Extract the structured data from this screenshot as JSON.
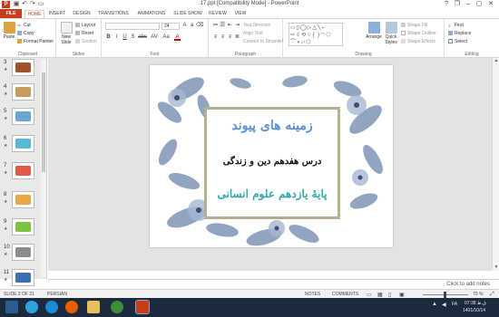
{
  "titlebar": {
    "title": "17.ppt [Compatibility Mode] - PowerPoint",
    "app_logo": "P",
    "quick_access": [
      "save-icon",
      "undo-icon",
      "redo-icon",
      "slideshow-icon"
    ],
    "controls": {
      "help": "?",
      "restore": "❐",
      "minimize": "–",
      "maximize": "▢",
      "close": "✕"
    }
  },
  "tabs": [
    "FILE",
    "HOME",
    "INSERT",
    "DESIGN",
    "TRANSITIONS",
    "ANIMATIONS",
    "SLIDE SHOW",
    "REVIEW",
    "VIEW"
  ],
  "active_tab": "HOME",
  "signin": "",
  "ribbon": {
    "clipboard": {
      "paste": "Paste",
      "cut": "Cut",
      "copy": "Copy",
      "format_painter": "Format Painter",
      "label": "Clipboard"
    },
    "slides": {
      "new_slide": "New Slide",
      "layout": "Layout",
      "reset": "Reset",
      "section": "Section",
      "label": "Slides"
    },
    "font": {
      "font_name": "",
      "font_size": "24",
      "label": "Font",
      "buttons": [
        "B",
        "I",
        "U",
        "S",
        "abc",
        "AV",
        "Aa",
        "A"
      ]
    },
    "paragraph": {
      "text_direction": "Text Direction",
      "align_text": "Align Text",
      "convert_smartart": "Convert to SmartArt",
      "label": "Paragraph"
    },
    "drawing": {
      "arrange": "Arrange",
      "quick_styles": "Quick Styles",
      "shape_fill": "Shape Fill",
      "shape_outline": "Shape Outline",
      "shape_effects": "Shape Effects",
      "label": "Drawing",
      "shapes_glyphs": "▭▯◯▷△╲⌐ ⇨⇩⟲☆{ }◠⬠ ⌒◖▱⬡"
    },
    "editing": {
      "find": "Find",
      "replace": "Replace",
      "select": "Select",
      "label": "Editing"
    }
  },
  "thumbnails": [
    {
      "number": "3",
      "star": "★",
      "selected": false,
      "color": "#a0522d"
    },
    {
      "number": "4",
      "star": "★",
      "selected": false,
      "color": "#c89b5c"
    },
    {
      "number": "5",
      "star": "★",
      "selected": false,
      "color": "#6aa5d8"
    },
    {
      "number": "6",
      "star": "★",
      "selected": false,
      "color": "#58b8d6"
    },
    {
      "number": "7",
      "star": "★",
      "selected": false,
      "color": "#e05a4a"
    },
    {
      "number": "8",
      "star": "★",
      "selected": false,
      "color": "#e8a742"
    },
    {
      "number": "9",
      "star": "★",
      "selected": false,
      "color": "#7bc143"
    },
    {
      "number": "10",
      "star": "★",
      "selected": false,
      "color": "#8c8c8c"
    },
    {
      "number": "11",
      "star": "★",
      "selected": false,
      "color": "#3d6fb0"
    }
  ],
  "slide": {
    "title": "زمینه های پیوند",
    "subtitle": "درس هفدهم دین و زندگی",
    "grade": "پایهٔ یازدهم علوم انسانی"
  },
  "notes_placeholder": "Click to add notes",
  "statusbar": {
    "slide_count": "SLIDE 2 OF 21",
    "language": "PERSIAN",
    "notes": "NOTES",
    "comments": "COMMENTS",
    "zoom": "70 %"
  },
  "taskbar": {
    "apps": [
      "start-icon",
      "telegram-icon",
      "internet-explorer-icon",
      "firefox-icon",
      "file-explorer-icon",
      "media-player-icon",
      "powerpoint-icon"
    ],
    "tray_text": "FA",
    "time": "07:38 ق.ظ",
    "date": "1401/10/14"
  },
  "colors": {
    "accent": "#c43e1c",
    "title_blue": "#5b8fd0",
    "grade_teal": "#2fa9a8",
    "frame": "#b5b092",
    "taskbar": "#1b2a3d"
  }
}
